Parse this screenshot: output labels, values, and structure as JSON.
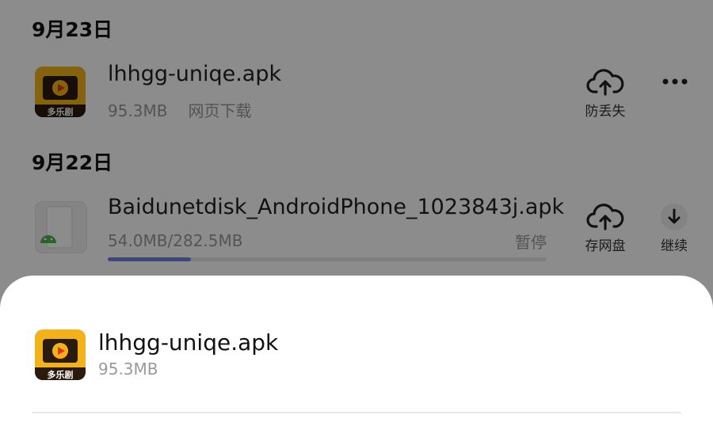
{
  "sections": [
    {
      "date": "9月23日"
    },
    {
      "date": "9月22日"
    }
  ],
  "items": [
    {
      "name": "lhhgg-uniqe.apk",
      "size": "95.3MB",
      "source": "网页下载",
      "icon_label": "多乐剧",
      "action_label": "防丢失"
    },
    {
      "name": "Baidunetdisk_AndroidPhone_1023843j.apk",
      "size": "54.0MB/282.5MB",
      "status": "暂停",
      "progress_fraction": 0.19,
      "action_label": "存网盘",
      "continue_label": "继续"
    }
  ],
  "sheet": {
    "title": "lhhgg-uniqe.apk",
    "size": "95.3MB",
    "icon_label": "多乐剧"
  },
  "colors": {
    "icon_bg": "#f3b21a",
    "progress": "#6d7cf0",
    "overlay": "rgba(0,0,0,0.45)"
  }
}
